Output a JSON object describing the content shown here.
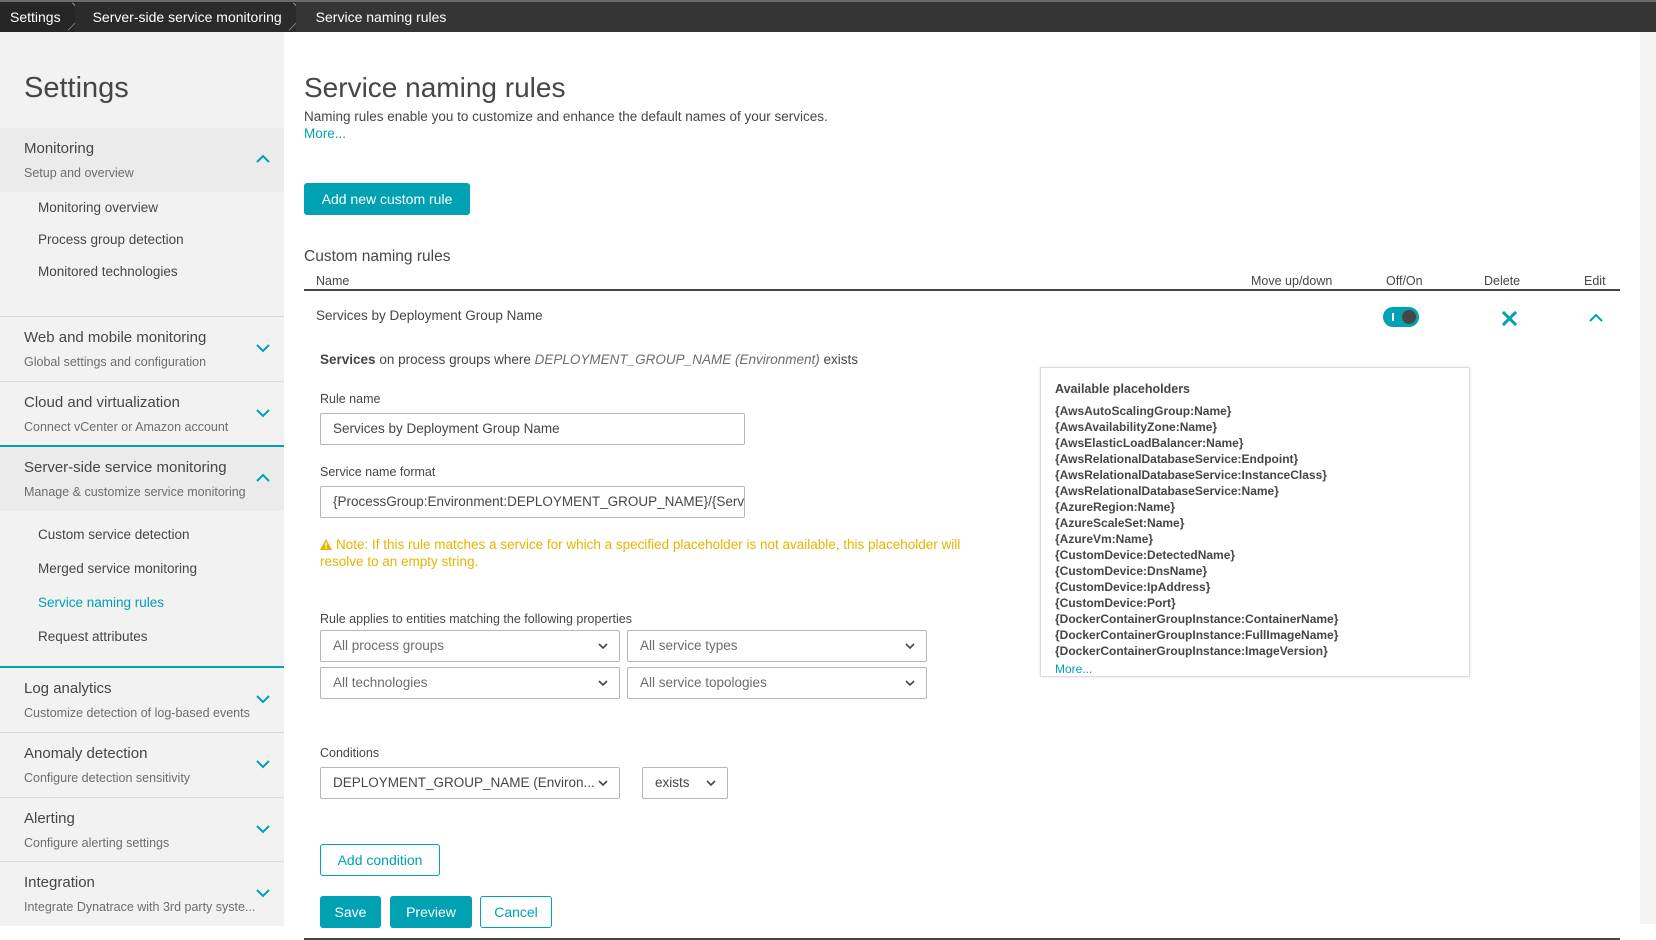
{
  "breadcrumb": [
    "Settings",
    "Server-side service monitoring",
    "Service naming rules"
  ],
  "sidebar": {
    "title": "Settings",
    "sections": [
      {
        "title": "Monitoring",
        "subtitle": "Setup and overview",
        "expanded": true,
        "items": [
          "Monitoring overview",
          "Process group detection",
          "Monitored technologies"
        ]
      },
      {
        "title": "Web and mobile monitoring",
        "subtitle": "Global settings and configuration",
        "expanded": false
      },
      {
        "title": "Cloud and virtualization",
        "subtitle": "Connect vCenter or Amazon account",
        "expanded": false
      },
      {
        "title": "Server-side service monitoring",
        "subtitle": "Manage & customize service monitoring",
        "expanded": true,
        "items": [
          "Custom service detection",
          "Merged service monitoring",
          "Service naming rules",
          "Request attributes"
        ],
        "active_item": "Service naming rules"
      },
      {
        "title": "Log analytics",
        "subtitle": "Customize detection of log-based events",
        "expanded": false
      },
      {
        "title": "Anomaly detection",
        "subtitle": "Configure detection sensitivity",
        "expanded": false
      },
      {
        "title": "Alerting",
        "subtitle": "Configure alerting settings",
        "expanded": false
      },
      {
        "title": "Integration",
        "subtitle": "Integrate Dynatrace with 3rd party syste...",
        "expanded": false
      }
    ]
  },
  "page": {
    "title": "Service naming rules",
    "description": "Naming rules enable you to customize and enhance the default names of your services.",
    "more_link": "More...",
    "add_rule_button": "Add new custom rule",
    "section_title": "Custom naming rules",
    "table_headers": {
      "name": "Name",
      "move": "Move up/down",
      "onoff": "Off/On",
      "delete": "Delete",
      "edit": "Edit"
    },
    "rule": {
      "name": "Services by Deployment Group Name",
      "enabled": true,
      "desc_bold": "Services",
      "desc_mid": " on process groups where ",
      "desc_italic": "DEPLOYMENT_GROUP_NAME (Environment)",
      "desc_end": " exists",
      "rule_name_label": "Rule name",
      "rule_name_value": "Services by Deployment Group Name",
      "format_label": "Service name format",
      "format_value": "{ProcessGroup:Environment:DEPLOYMENT_GROUP_NAME}/{Serv",
      "note_icon": "warning-icon",
      "note": "Note: If this rule matches a service for which a specified placeholder is not available, this placeholder will resolve to an empty string.",
      "applies_label": "Rule applies to entities matching the following properties",
      "filters": {
        "process_groups": "All process groups",
        "service_types": "All service types",
        "technologies": "All technologies",
        "service_topologies": "All service topologies"
      },
      "conditions_label": "Conditions",
      "condition_property": "DEPLOYMENT_GROUP_NAME (Environ...",
      "condition_operator": "exists",
      "add_condition_button": "Add condition",
      "save_button": "Save",
      "preview_button": "Preview",
      "cancel_button": "Cancel"
    },
    "placeholders": {
      "title": "Available placeholders",
      "items": [
        "{AwsAutoScalingGroup:Name}",
        "{AwsAvailabilityZone:Name}",
        "{AwsElasticLoadBalancer:Name}",
        "{AwsRelationalDatabaseService:Endpoint}",
        "{AwsRelationalDatabaseService:InstanceClass}",
        "{AwsRelationalDatabaseService:Name}",
        "{AzureRegion:Name}",
        "{AzureScaleSet:Name}",
        "{AzureVm:Name}",
        "{CustomDevice:DetectedName}",
        "{CustomDevice:DnsName}",
        "{CustomDevice:IpAddress}",
        "{CustomDevice:Port}",
        "{DockerContainerGroupInstance:ContainerName}",
        "{DockerContainerGroupInstance:FullImageName}",
        "{DockerContainerGroupInstance:ImageVersion}"
      ],
      "more": "More..."
    }
  },
  "colors": {
    "accent": "#00a1b2",
    "warning": "#e6b400",
    "text": "#454646",
    "topbar": "#353535"
  }
}
